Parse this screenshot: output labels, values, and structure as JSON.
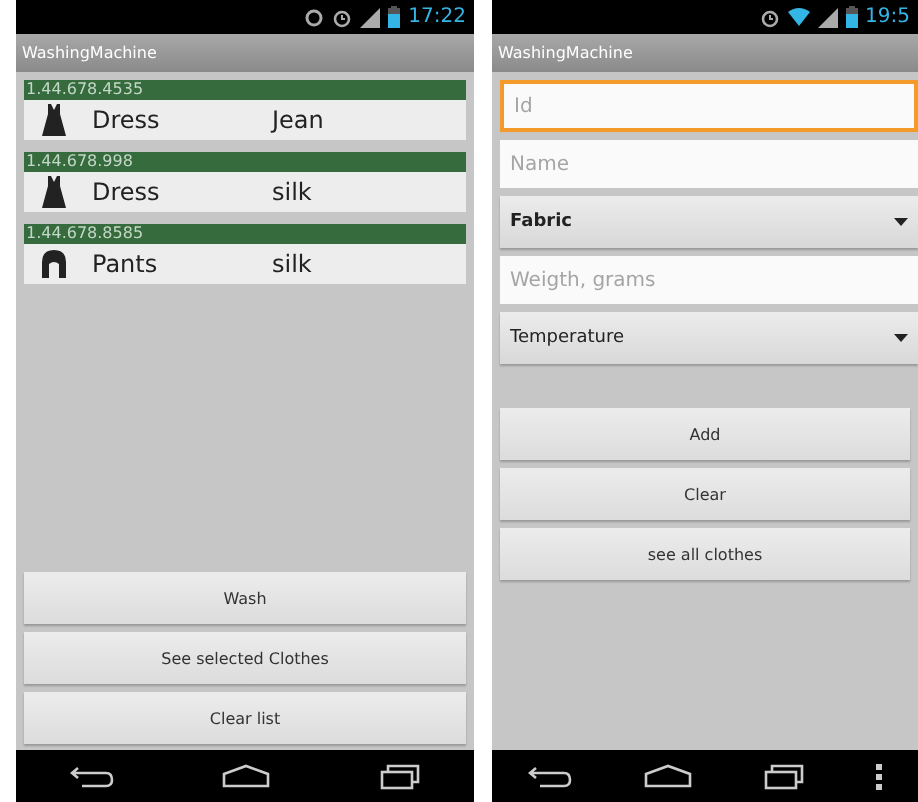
{
  "screens": [
    {
      "kind": "list",
      "status_bar": {
        "time": "17:22"
      },
      "title": "WashingMachine",
      "clothes": [
        {
          "id": "1.44.678.4535",
          "kind": "dress",
          "name": "Dress",
          "fabric": "Jean"
        },
        {
          "id": "1.44.678.998",
          "kind": "dress",
          "name": "Dress",
          "fabric": "silk"
        },
        {
          "id": "1.44.678.8585",
          "kind": "pants",
          "name": "Pants",
          "fabric": "silk"
        }
      ],
      "buttons": [
        "Wash",
        "See selected Clothes",
        "Clear list"
      ]
    },
    {
      "kind": "form",
      "status_bar": {
        "time": "19:5"
      },
      "title": "WashingMachine",
      "fields": [
        {
          "kind": "text",
          "placeholder": "Id",
          "focused": true
        },
        {
          "kind": "text",
          "placeholder": "Name",
          "focused": false
        },
        {
          "kind": "spinner",
          "value": "Fabric",
          "bold": true
        },
        {
          "kind": "text",
          "placeholder": "Weigth, grams",
          "focused": false
        },
        {
          "kind": "spinner",
          "value": "Temperature",
          "bold": false
        }
      ],
      "buttons": [
        "Add",
        "Clear",
        "see all clothes"
      ]
    }
  ]
}
